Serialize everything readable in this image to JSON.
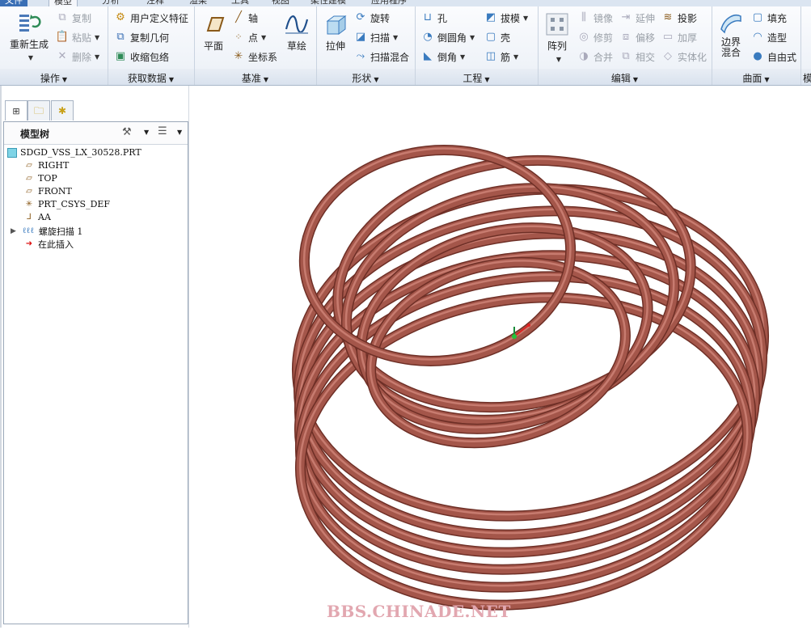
{
  "top_tabs": [
    {
      "label": "文件"
    },
    {
      "label": "模型"
    },
    {
      "label": "分析"
    },
    {
      "label": "注释"
    },
    {
      "label": "渲染"
    },
    {
      "label": "工具"
    },
    {
      "label": "视图"
    },
    {
      "label": "柔性建模"
    },
    {
      "label": "应用程序"
    }
  ],
  "ribbon": {
    "operations": {
      "regenerate": "重新生成",
      "copy": "复制",
      "paste": "粘贴",
      "delete": "删除",
      "group": "操作"
    },
    "get_data": {
      "udf": "用户定义特征",
      "copy_geom": "复制几何",
      "shrinkwrap": "收缩包络",
      "group": "获取数据"
    },
    "datum": {
      "plane": "平面",
      "axis": "轴",
      "point": "点",
      "csys": "坐标系",
      "sketch": "草绘",
      "group": "基准"
    },
    "shapes": {
      "extrude": "拉伸",
      "revolve": "旋转",
      "sweep": "扫描",
      "swept_blend": "扫描混合",
      "group": "形状"
    },
    "engineering": {
      "hole": "孔",
      "round": "倒圆角",
      "chamfer": "倒角",
      "draft": "拔模",
      "shell": "壳",
      "rib": "筋",
      "group": "工程"
    },
    "editing": {
      "pattern": "阵列",
      "mirror": "镜像",
      "extend": "延伸",
      "project": "投影",
      "trim": "修剪",
      "offset": "偏移",
      "thicken": "加厚",
      "merge": "合并",
      "intersect": "相交",
      "solidify": "实体化",
      "group": "编辑"
    },
    "surfaces": {
      "boundary_blend": "边界混合",
      "fill": "填充",
      "style": "造型",
      "freestyle": "自由式",
      "group": "曲面"
    },
    "last_group_partial": "模"
  },
  "model_tree": {
    "title": "模型树",
    "items": [
      {
        "label": "SDGD_VSS_LX_30528.PRT",
        "icon": "part-icon"
      },
      {
        "label": "RIGHT",
        "icon": "datum-plane-icon"
      },
      {
        "label": "TOP",
        "icon": "datum-plane-icon"
      },
      {
        "label": "FRONT",
        "icon": "datum-plane-icon"
      },
      {
        "label": "PRT_CSYS_DEF",
        "icon": "csys-icon"
      },
      {
        "label": "AA",
        "icon": "datum-axis-icon"
      },
      {
        "label": "螺旋扫描 1",
        "icon": "helical-sweep-icon"
      },
      {
        "label": "在此插入",
        "icon": "insert-here-arrow-icon"
      }
    ]
  },
  "colors": {
    "coil": "#a4564a",
    "coil_highlight": "#cf8578",
    "ribbon_bg": "#eef2f8",
    "tab_file": "#3a6fb5"
  },
  "watermark": "BBS.CHINADE.NET"
}
